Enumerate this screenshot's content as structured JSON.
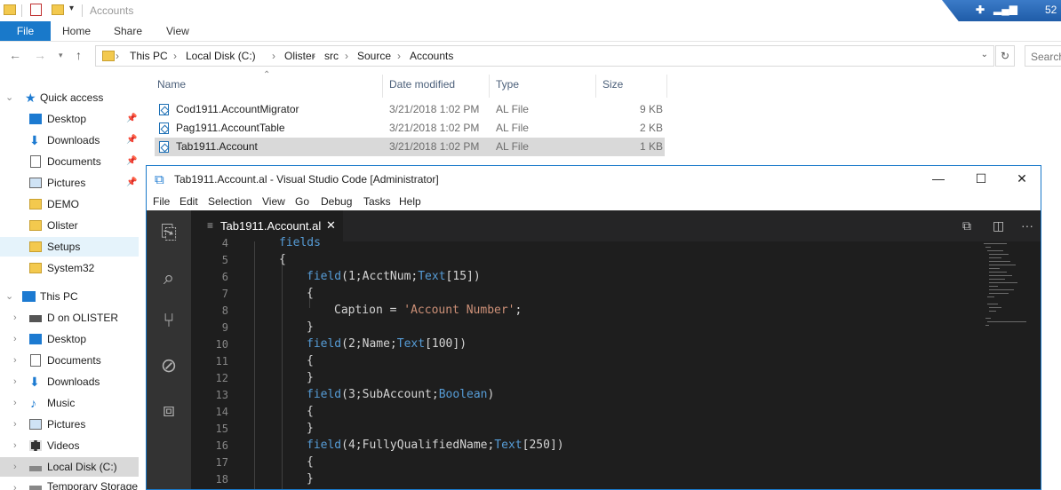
{
  "explorer": {
    "title": "Accounts",
    "taskbar_text": "52",
    "ribbon_tabs": [
      "File",
      "Home",
      "Share",
      "View"
    ],
    "breadcrumbs": [
      "This PC",
      "Local Disk (C:)",
      "Olister",
      "src",
      "Source",
      "Accounts"
    ],
    "search_placeholder": "Search"
  },
  "nav_pane": {
    "quick_access": "Quick access",
    "quick_items": [
      "Desktop",
      "Downloads",
      "Documents",
      "Pictures",
      "DEMO",
      "Olister",
      "Setups",
      "System32"
    ],
    "this_pc": "This PC",
    "pc_items": [
      "D on OLISTER",
      "Desktop",
      "Documents",
      "Downloads",
      "Music",
      "Pictures",
      "Videos",
      "Local Disk (C:)",
      "Temporary Storage"
    ]
  },
  "file_list": {
    "columns": [
      "Name",
      "Date modified",
      "Type",
      "Size"
    ],
    "rows": [
      {
        "name": "Cod1911.AccountMigrator",
        "date": "3/21/2018 1:02 PM",
        "type": "AL File",
        "size": "9 KB"
      },
      {
        "name": "Pag1911.AccountTable",
        "date": "3/21/2018 1:02 PM",
        "type": "AL File",
        "size": "2 KB"
      },
      {
        "name": "Tab1911.Account",
        "date": "3/21/2018 1:02 PM",
        "type": "AL File",
        "size": "1 KB"
      }
    ]
  },
  "vscode": {
    "window_title": "Tab1911.Account.al - Visual Studio Code [Administrator]",
    "menu": [
      "File",
      "Edit",
      "Selection",
      "View",
      "Go",
      "Debug",
      "Tasks",
      "Help"
    ],
    "tab_label": "Tab1911.Account.al",
    "line_numbers": [
      "4",
      "5",
      "6",
      "7",
      "8",
      "9",
      "10",
      "11",
      "12",
      "13",
      "14",
      "15",
      "16",
      "17",
      "18"
    ],
    "code": {
      "l4": "fields",
      "l5": "{",
      "l6_fn": "field",
      "l6_args": "(1;AcctNum;",
      "l6_type": "Text",
      "l6_end": "[15])",
      "l7": "{",
      "l8_a": "Caption = ",
      "l8_str": "'Account Number'",
      "l8_b": ";",
      "l9": "}",
      "l10_fn": "field",
      "l10_args": "(2;Name;",
      "l10_type": "Text",
      "l10_end": "[100])",
      "l11": "{",
      "l12": "}",
      "l13_fn": "field",
      "l13_args": "(3;SubAccount;",
      "l13_type": "Boolean",
      "l13_end": ")",
      "l14": "{",
      "l15": "}",
      "l16_fn": "field",
      "l16_args": "(4;FullyQualifiedName;",
      "l16_type": "Text",
      "l16_end": "[250])",
      "l17": "{",
      "l18": "}"
    }
  }
}
